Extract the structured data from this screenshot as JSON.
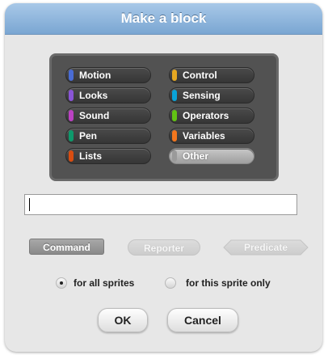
{
  "dialog": {
    "title": "Make a block"
  },
  "categories": [
    {
      "label": "Motion",
      "color": "#4a6cd4"
    },
    {
      "label": "Control",
      "color": "#e6a822"
    },
    {
      "label": "Looks",
      "color": "#8a55d7"
    },
    {
      "label": "Sensing",
      "color": "#0aa3d8"
    },
    {
      "label": "Sound",
      "color": "#bb42c3"
    },
    {
      "label": "Operators",
      "color": "#62c213"
    },
    {
      "label": "Pen",
      "color": "#0e9a6c"
    },
    {
      "label": "Variables",
      "color": "#f3761d"
    },
    {
      "label": "Lists",
      "color": "#d94d11"
    },
    {
      "label": "Other",
      "color": "#9a9a9a",
      "selected": true
    }
  ],
  "input": {
    "value": ""
  },
  "shapes": {
    "command": "Command",
    "reporter": "Reporter",
    "predicate": "Predicate"
  },
  "scope": {
    "all_sprites": "for all sprites",
    "this_sprite": "for this sprite only",
    "selected": "all_sprites"
  },
  "buttons": {
    "ok": "OK",
    "cancel": "Cancel"
  }
}
